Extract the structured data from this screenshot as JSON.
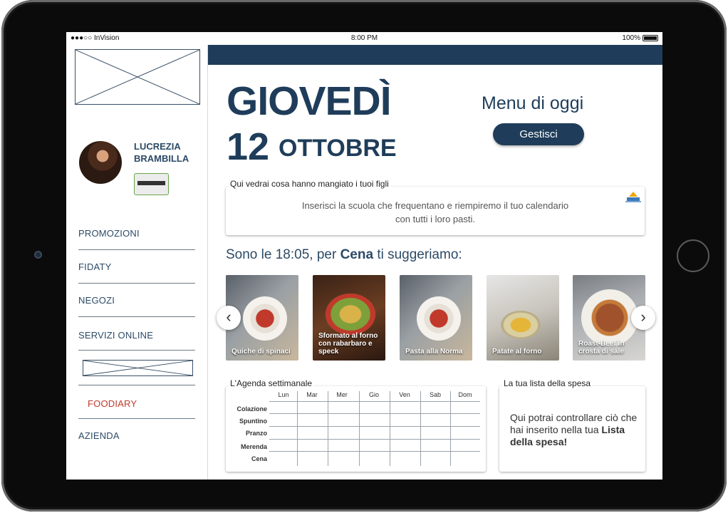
{
  "statusbar": {
    "carrier": "●●●○○ InVision",
    "time": "8:00 PM",
    "battery": "100%"
  },
  "sidebar": {
    "user_name": "LUCREZIA BRAMBILLA",
    "items": [
      {
        "label": "PROMOZIONI"
      },
      {
        "label": "FIDATY"
      },
      {
        "label": "NEGOZI"
      },
      {
        "label": "SERVIZI ONLINE"
      },
      {
        "label": "FOODIARY"
      },
      {
        "label": "AZIENDA"
      }
    ],
    "active_item": "FOODIARY",
    "active_color": "#c0392b"
  },
  "header": {
    "day": "GIOVEDÌ",
    "date_number": "12",
    "date_month": "OTTOBRE",
    "menu_title": "Menu di oggi",
    "manage_button": "Gestisci"
  },
  "kids_box": {
    "label": "Qui vedrai cosa hanno mangiato i tuoi figli",
    "text_line1": "Inserisci la scuola che frequentano e riempiremo il tuo calendario",
    "text_line2": "con tutti i loro pasti."
  },
  "suggestion": {
    "prefix": "Sono le 18:05, per ",
    "meal": "Cena",
    "suffix": " ti suggeriamo:"
  },
  "recipes": [
    {
      "name": "Quiche di spinaci",
      "icon": "food-photo"
    },
    {
      "name": "Sformato al forno con rabarbaro e speck",
      "icon": "food-photo"
    },
    {
      "name": "Pasta alla Norma",
      "icon": "food-photo"
    },
    {
      "name": "Patate al forno",
      "icon": "food-photo"
    },
    {
      "name": "Roast-Beef in crosta di sale",
      "icon": "food-photo"
    }
  ],
  "agenda": {
    "title": "L'Agenda settimanale",
    "days": [
      "Lun",
      "Mar",
      "Mer",
      "Gio",
      "Ven",
      "Sab",
      "Dom"
    ],
    "meals": [
      "Colazione",
      "Spuntino",
      "Pranzo",
      "Merenda",
      "Cena"
    ]
  },
  "shopping": {
    "title": "La tua lista della spesa",
    "text": "Qui potrai controllare ciò che hai inserito nella tua",
    "bold": "Lista della spesa!"
  },
  "colors": {
    "primary": "#1f3d5a",
    "accent": "#c0392b"
  }
}
